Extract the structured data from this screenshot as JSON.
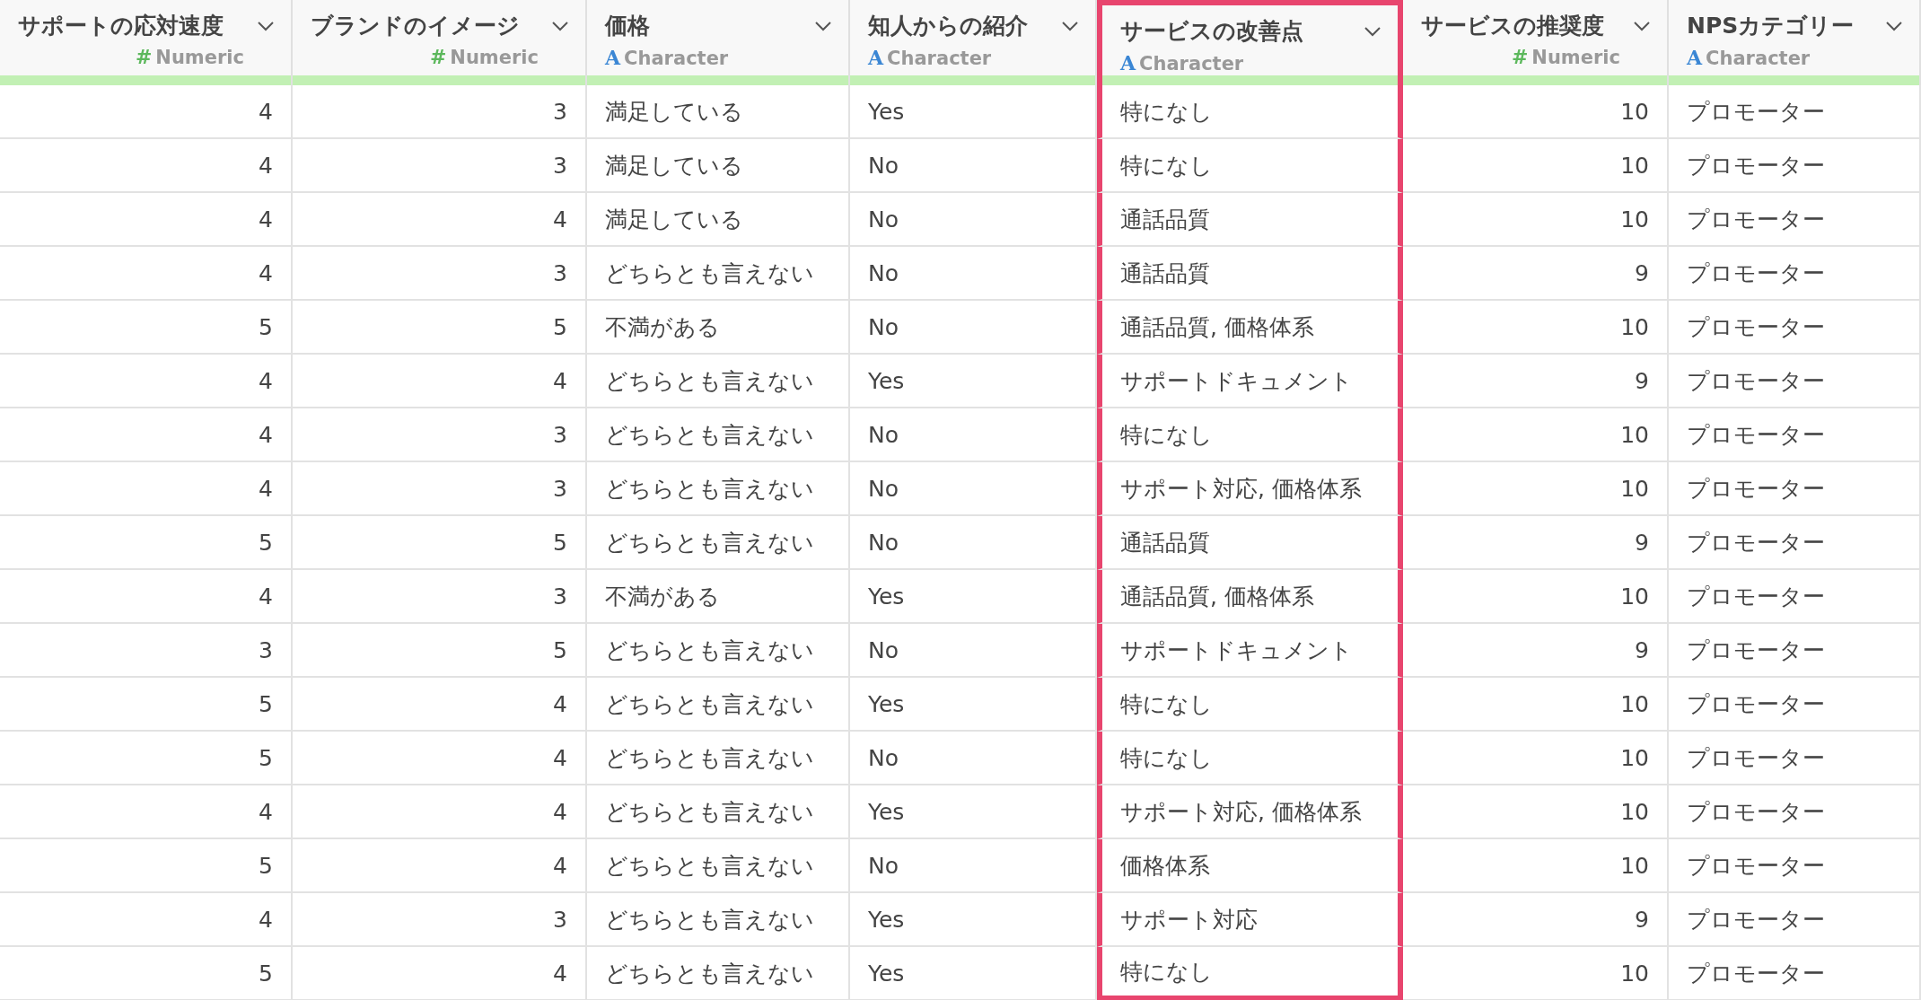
{
  "table": {
    "columns": [
      {
        "title": "サポートの応対速度",
        "kind": "numeric",
        "type_icon": "#",
        "type_label": "Numeric",
        "highlighted": false
      },
      {
        "title": "ブランドのイメージ",
        "kind": "numeric",
        "type_icon": "#",
        "type_label": "Numeric",
        "highlighted": false
      },
      {
        "title": "価格",
        "kind": "character",
        "type_icon": "A",
        "type_label": "Character",
        "highlighted": false
      },
      {
        "title": "知人からの紹介",
        "kind": "character",
        "type_icon": "A",
        "type_label": "Character",
        "highlighted": false
      },
      {
        "title": "サービスの改善点",
        "kind": "character",
        "type_icon": "A",
        "type_label": "Character",
        "highlighted": true
      },
      {
        "title": "サービスの推奨度",
        "kind": "numeric",
        "type_icon": "#",
        "type_label": "Numeric",
        "highlighted": false
      },
      {
        "title": "NPSカテゴリー",
        "kind": "character",
        "type_icon": "A",
        "type_label": "Character",
        "highlighted": false
      }
    ],
    "rows": [
      [
        "4",
        "3",
        "満足している",
        "Yes",
        "特になし",
        "10",
        "プロモーター"
      ],
      [
        "4",
        "3",
        "満足している",
        "No",
        "特になし",
        "10",
        "プロモーター"
      ],
      [
        "4",
        "4",
        "満足している",
        "No",
        "通話品質",
        "10",
        "プロモーター"
      ],
      [
        "4",
        "3",
        "どちらとも言えない",
        "No",
        "通話品質",
        "9",
        "プロモーター"
      ],
      [
        "5",
        "5",
        "不満がある",
        "No",
        "通話品質, 価格体系",
        "10",
        "プロモーター"
      ],
      [
        "4",
        "4",
        "どちらとも言えない",
        "Yes",
        "サポートドキュメント",
        "9",
        "プロモーター"
      ],
      [
        "4",
        "3",
        "どちらとも言えない",
        "No",
        "特になし",
        "10",
        "プロモーター"
      ],
      [
        "4",
        "3",
        "どちらとも言えない",
        "No",
        "サポート対応, 価格体系",
        "10",
        "プロモーター"
      ],
      [
        "5",
        "5",
        "どちらとも言えない",
        "No",
        "通話品質",
        "9",
        "プロモーター"
      ],
      [
        "4",
        "3",
        "不満がある",
        "Yes",
        "通話品質, 価格体系",
        "10",
        "プロモーター"
      ],
      [
        "3",
        "5",
        "どちらとも言えない",
        "No",
        "サポートドキュメント",
        "9",
        "プロモーター"
      ],
      [
        "5",
        "4",
        "どちらとも言えない",
        "Yes",
        "特になし",
        "10",
        "プロモーター"
      ],
      [
        "5",
        "4",
        "どちらとも言えない",
        "No",
        "特になし",
        "10",
        "プロモーター"
      ],
      [
        "4",
        "4",
        "どちらとも言えない",
        "Yes",
        "サポート対応, 価格体系",
        "10",
        "プロモーター"
      ],
      [
        "5",
        "4",
        "どちらとも言えない",
        "No",
        "価格体系",
        "10",
        "プロモーター"
      ],
      [
        "4",
        "3",
        "どちらとも言えない",
        "Yes",
        "サポート対応",
        "9",
        "プロモーター"
      ],
      [
        "5",
        "4",
        "どちらとも言えない",
        "Yes",
        "特になし",
        "10",
        "プロモーター"
      ]
    ]
  }
}
